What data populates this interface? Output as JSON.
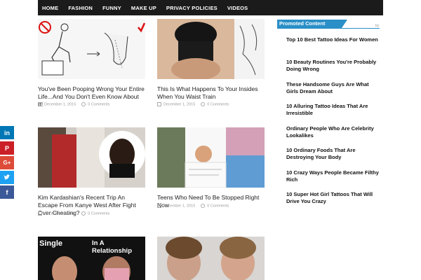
{
  "nav": {
    "items": [
      "HOME",
      "FASHION",
      "FUNNY",
      "MAKE UP",
      "PRIVACY POLICIES",
      "VIDEOS"
    ]
  },
  "articles": [
    {
      "title": "You've Been Pooping Wrong Your Entire Life...And You Don't Even Know About It!",
      "date": "December 1, 2015",
      "comments": "0 Comments"
    },
    {
      "title": "This Is What Happens To Your Insides When You Waist Train",
      "date": "December 1, 2015",
      "comments": "0 Comments"
    },
    {
      "title": "Kim Kardashian's Recent Trip An Escape From Kanye West After Fight Over Cheating?",
      "date": "December 1, 2015",
      "comments": "0 Comments"
    },
    {
      "title": "Teens Who Need To Be Stopped Right Now",
      "date": "December 1, 2015",
      "comments": "0 Comments"
    }
  ],
  "thumb_texts": {
    "relationship_single": "Single",
    "relationship_in": "In A Relationship"
  },
  "promoted": {
    "heading": "Promoted Content",
    "by": "by",
    "items": [
      "Top 10 Best Tattoo Ideas For Women",
      "10 Beauty Routines You're Probably Doing Wrong",
      "These Handsome Guys Are What Girls Dream About",
      "10 Alluring Tattoo Ideas That Are Irresistible",
      "Ordinary People Who Are Celebrity Lookalikes",
      "10 Ordinary Foods That Are Destroying Your Body",
      "10 Crazy Ways People Became Filthy Rich",
      "10 Super Hot Girl Tattoos That Will Drive You Crazy"
    ]
  },
  "share": {
    "colors": {
      "linkedin": "#0077b5",
      "pinterest": "#cb2027",
      "googleplus": "#dd4b39",
      "twitter": "#1da1f2",
      "facebook": "#3b5998"
    }
  }
}
